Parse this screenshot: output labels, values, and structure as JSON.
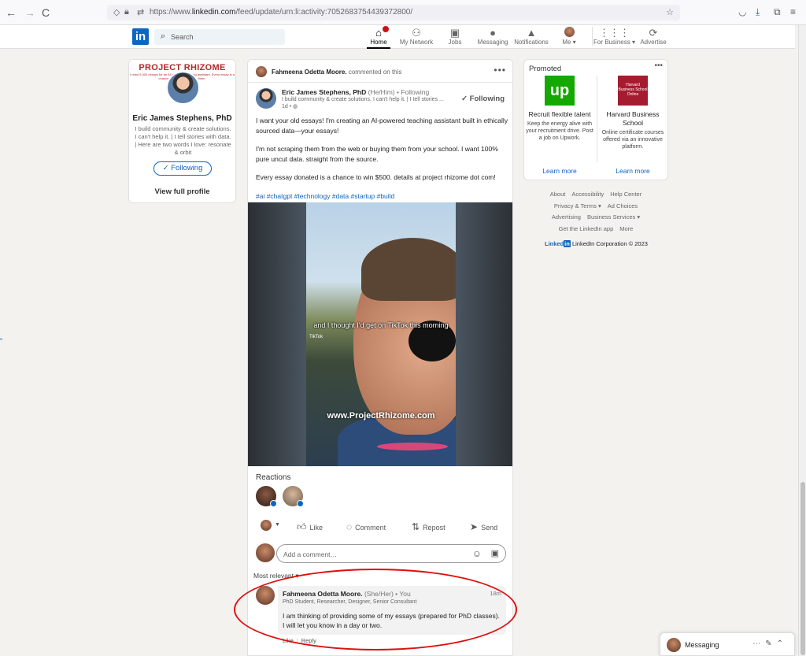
{
  "browser": {
    "back": "←",
    "forward": "→",
    "reload": "C",
    "url_prefix": "https://www.",
    "url_domain": "linkedin.com",
    "url_path": "/feed/update/urn:li:activity:7052683754439372800/"
  },
  "header": {
    "logo": "in",
    "search_placeholder": "Search",
    "nav": [
      {
        "label": "Home",
        "icon": "home-icon"
      },
      {
        "label": "My Network",
        "icon": "network-icon"
      },
      {
        "label": "Jobs",
        "icon": "briefcase-icon"
      },
      {
        "label": "Messaging",
        "icon": "chat-icon"
      },
      {
        "label": "Notifications",
        "icon": "bell-icon"
      },
      {
        "label": "Me ▾",
        "icon": "avatar"
      },
      {
        "label": "For Business ▾",
        "icon": "grid-icon"
      },
      {
        "label": "Advertise",
        "icon": "advertise-icon"
      }
    ]
  },
  "profile": {
    "banner_title": "PROJECT RHIZOME",
    "banner_sub": "I need 5,000 essays for an AI-powered teaching assistant. Every essay is a chance to win $5,000 to get them.",
    "name": "Eric James Stephens, PhD",
    "headline": "I build community & create solutions. I can't help it. | I tell stories with data. | Here are two words I love: resonate & orbit",
    "following_label": "✓ Following",
    "view_profile": "View full profile"
  },
  "post": {
    "context_name": "Fahmeena Odetta Moore.",
    "context_action": "commented on this",
    "more": "•••",
    "author_name": "Eric James Stephens, PhD",
    "author_meta": "(He/Him) • Following",
    "author_headline": "I build community & create solutions. I can't help it. | I tell stories ...",
    "author_time": "1d •",
    "follow_label": "✓ Following",
    "paragraphs": [
      "I want your old essays! I'm creating an AI-powered teaching assistant built in ethically sourced data—your essays!",
      "I'm not scraping them from the web or buying them from your school. I want 100% pure uncut data. straight from the source.",
      "Every essay donated is a chance to win $500. details at project rhizome dot com!"
    ],
    "hashtags": "#ai #chatgpt #technology #data #startup #build",
    "video_caption": "and I thought I'd get on TikTok this morning",
    "video_tiktok": "TikTok",
    "video_watermark": "www.ProjectRhizome.com",
    "reactions_title": "Reactions",
    "actions": {
      "like": "Like",
      "comment": "Comment",
      "repost": "Repost",
      "send": "Send"
    },
    "comment_placeholder": "Add a comment…",
    "sort_label": "Most relevant ▾",
    "comment": {
      "name": "Fahmeena Odetta Moore.",
      "meta": "(She/Her) • You",
      "time": "18m",
      "headline": "PhD Student, Researcher, Designer, Senior Consultant",
      "text": "I am thinking of providing some of my essays (prepared for PhD classes). I will let you know in a day or two.",
      "like": "Like",
      "reply": "Reply"
    }
  },
  "ad": {
    "title": "Promoted",
    "more": "•••",
    "items": [
      {
        "logo": "up",
        "headline": "Recruit flexible talent",
        "desc": "Keep the energy alive with your recruitment drive. Post a job on Upwork.",
        "link": "Learn more"
      },
      {
        "logo": "Harvard Business School Online",
        "headline": "Harvard Business School",
        "desc": "Online certificate courses offered via an innovative platform.",
        "link": "Learn more"
      }
    ]
  },
  "footer": {
    "links": [
      "About",
      "Accessibility",
      "Help Center",
      "Privacy & Terms ▾",
      "Ad Choices",
      "Advertising",
      "Business Services ▾",
      "Get the LinkedIn app",
      "More"
    ],
    "brand": "LinkedIn Corporation © 2023"
  },
  "messaging": {
    "label": "Messaging"
  },
  "colors": {
    "brand": "#0a66c2",
    "annotation": "#dd1111",
    "upwork": "#14a800",
    "hbs": "#a51c30"
  }
}
